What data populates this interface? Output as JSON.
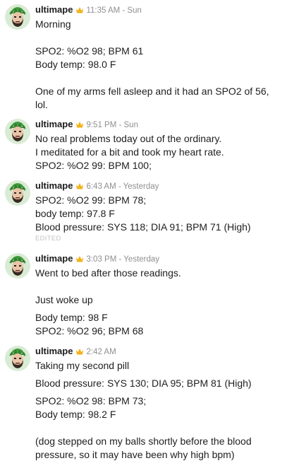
{
  "icons": {
    "avatar": "avatar-green-hair-bearded-face",
    "crown": "crown-icon"
  },
  "colors": {
    "avatar_bg": "#d9ebd4",
    "hair": "#3f9a3b",
    "crown": "#f2b21b",
    "meta": "#8f8f8f"
  },
  "messages": [
    {
      "author": "ultimape",
      "time": "11:35 AM - Sun",
      "lines": [
        "Morning",
        "",
        "SPO2: %O2 98; BPM 61",
        "Body temp: 98.0 F",
        "",
        "One of my arms fell asleep and it had an SPO2 of 56, lol."
      ]
    },
    {
      "author": "ultimape",
      "time": "9:51 PM - Sun",
      "lines": [
        "No real problems today out of the ordinary.",
        "I meditated for a bit and took my heart rate.",
        "SPO2: %O2 99: BPM 100;"
      ]
    },
    {
      "author": "ultimape",
      "time": "6:43 AM - Yesterday",
      "lines": [
        "SPO2: %O2 99: BPM 78;",
        "body temp: 97.8 F",
        "Blood pressure: SYS 118; DIA 91; BPM 71 (High)"
      ],
      "edited": "EDITED"
    },
    {
      "author": "ultimape",
      "time": "3:03 PM - Yesterday",
      "lines": [
        "Went to bed after those readings.",
        "",
        "Just woke up",
        "Body temp: 98 F",
        "SPO2: %O2 96; BPM 68"
      ]
    },
    {
      "author": "ultimape",
      "time": "2:42 AM",
      "lines": [
        "Taking my second pill",
        "Blood pressure: SYS 130; DIA 95; BPM 81 (High)",
        "SPO2: %O2 98: BPM 73;",
        "Body temp: 98.2 F",
        "",
        "(dog stepped on my balls shortly before the blood pressure, so it may have been why high bpm)"
      ]
    }
  ]
}
